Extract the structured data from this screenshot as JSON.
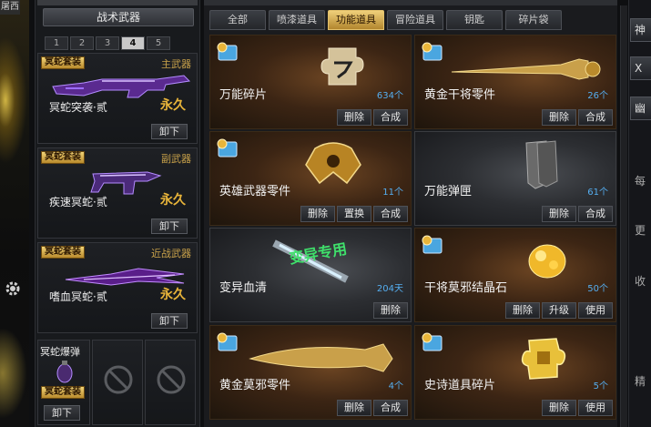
{
  "left_edge": {
    "top_tag": "屠西"
  },
  "loadout": {
    "title": "战术武器",
    "slot_tabs": [
      "1",
      "2",
      "3",
      "4",
      "5"
    ],
    "active_slot": "4",
    "cards": [
      {
        "badge": "冥蛇套装",
        "type": "主武器",
        "name": "冥蛇突袭·贰",
        "perm": "永久",
        "button": "卸下"
      },
      {
        "badge": "冥蛇套装",
        "type": "副武器",
        "name": "疾速冥蛇·贰",
        "perm": "永久",
        "button": "卸下"
      },
      {
        "badge": "冥蛇套装",
        "type": "近战武器",
        "name": "嗜血冥蛇·贰",
        "perm": "永久",
        "button": "卸下"
      }
    ],
    "grenade": {
      "name": "冥蛇爆弹",
      "badge": "冥蛇套装",
      "button": "卸下"
    }
  },
  "tabs": [
    "全部",
    "喷漆道具",
    "功能道具",
    "冒险道具",
    "钥匙",
    "碎片袋"
  ],
  "active_tab": "功能道具",
  "items": [
    {
      "name": "万能碎片",
      "count": "634个",
      "buttons": [
        "删除",
        "合成"
      ],
      "art": "puzzle-icon"
    },
    {
      "name": "黄金干将零件",
      "count": "26个",
      "buttons": [
        "删除",
        "合成"
      ],
      "art": "golden-sword-icon"
    },
    {
      "name": "英雄武器零件",
      "count": "11个",
      "buttons": [
        "删除",
        "置换",
        "合成"
      ],
      "art": "hero-emblem-icon"
    },
    {
      "name": "万能弹匣",
      "count": "61个",
      "buttons": [
        "删除",
        "合成"
      ],
      "art": "magazine-icon"
    },
    {
      "name": "变异血清",
      "count": "204天",
      "buttons": [
        "删除"
      ],
      "art": "serum-icon",
      "overlay": "变异专用"
    },
    {
      "name": "干将莫邪结晶石",
      "count": "50个",
      "buttons": [
        "删除",
        "升级",
        "使用"
      ],
      "art": "crystal-icon"
    },
    {
      "name": "黄金莫邪零件",
      "count": "4个",
      "buttons": [
        "删除",
        "合成"
      ],
      "art": "golden-blade-icon"
    },
    {
      "name": "史诗道具碎片",
      "count": "5个",
      "buttons": [
        "删除",
        "使用"
      ],
      "art": "epic-puzzle-icon"
    }
  ],
  "right_panel": {
    "buttons": [
      "神",
      "X",
      "幽"
    ],
    "texts": [
      "每",
      "更",
      "收",
      "精"
    ]
  },
  "colors": {
    "accent_gold": "#e9b53a",
    "count_blue": "#55aef0",
    "selected_border": "#7fb9e6"
  }
}
